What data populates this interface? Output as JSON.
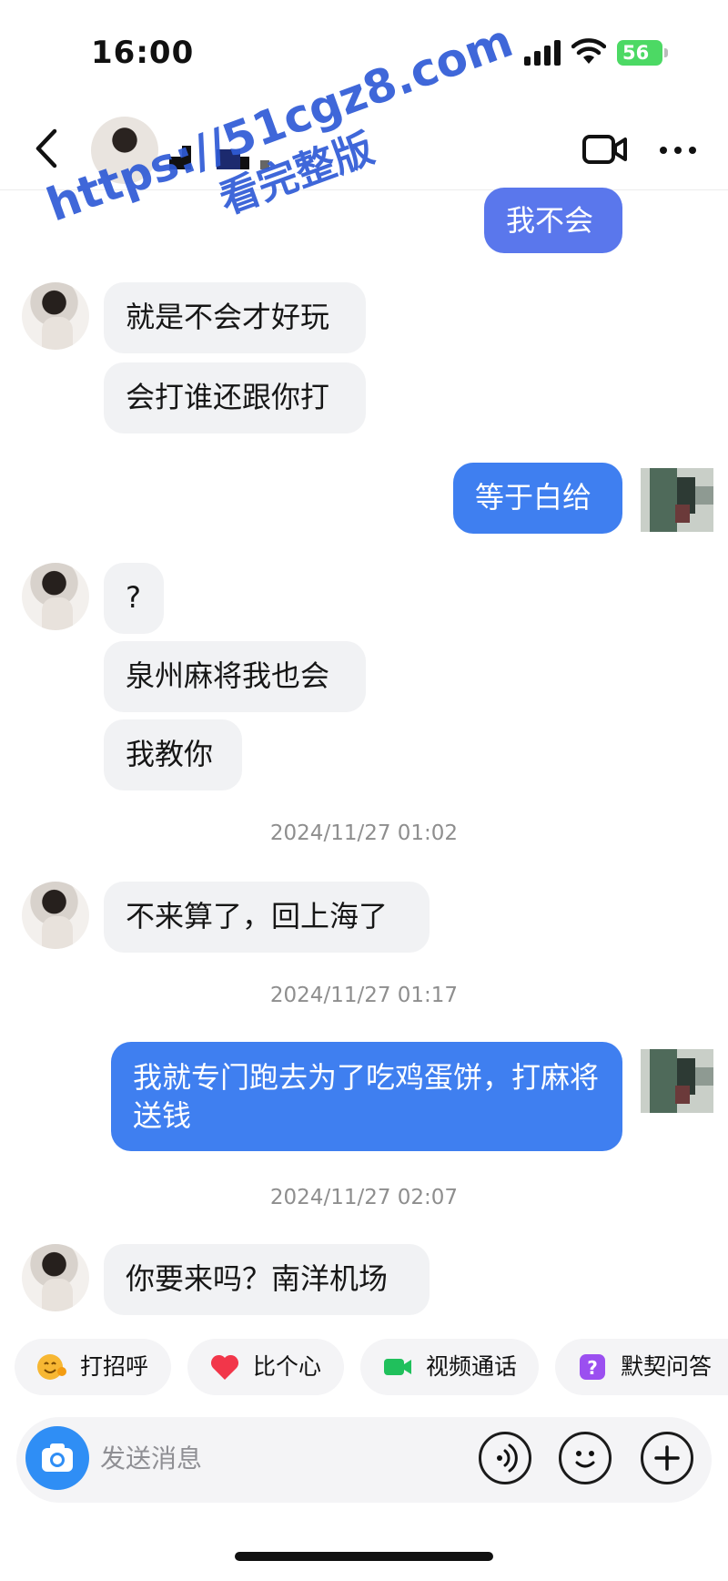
{
  "status_bar": {
    "time": "16:00",
    "battery": "56"
  },
  "header": {
    "back_label": "<"
  },
  "watermark": {
    "url": "https://51cgz8.com",
    "caption": "看完整版"
  },
  "messages": [
    {
      "side": "out",
      "text": "我不会"
    },
    {
      "side": "in",
      "text": "就是不会才好玩"
    },
    {
      "side": "in",
      "text": "会打谁还跟你打"
    },
    {
      "side": "out",
      "text": "等于白给"
    },
    {
      "side": "in",
      "text": "?"
    },
    {
      "side": "in",
      "text": "泉州麻将我也会"
    },
    {
      "side": "in",
      "text": "我教你"
    },
    {
      "side": "in",
      "text": "不来算了，回上海了"
    },
    {
      "side": "out",
      "text": "我就专门跑去为了吃鸡蛋饼，打麻将送钱"
    },
    {
      "side": "in",
      "text": "你要来吗？南洋机场"
    }
  ],
  "timestamps": [
    "2024/11/27 01:02",
    "2024/11/27 01:17",
    "2024/11/27 02:07"
  ],
  "quick_actions": [
    {
      "label": "打招呼",
      "icon": "smile-wave-icon"
    },
    {
      "label": "比个心",
      "icon": "heart-icon"
    },
    {
      "label": "视频通话",
      "icon": "video-call-icon"
    },
    {
      "label": "默契问答",
      "icon": "question-box-icon"
    }
  ],
  "input": {
    "placeholder": "发送消息"
  },
  "colors": {
    "out_bubble": "#3f7ff0",
    "in_bubble": "#f1f2f4",
    "camera": "#2f8ef5",
    "watermark": "#2f5bd6"
  }
}
